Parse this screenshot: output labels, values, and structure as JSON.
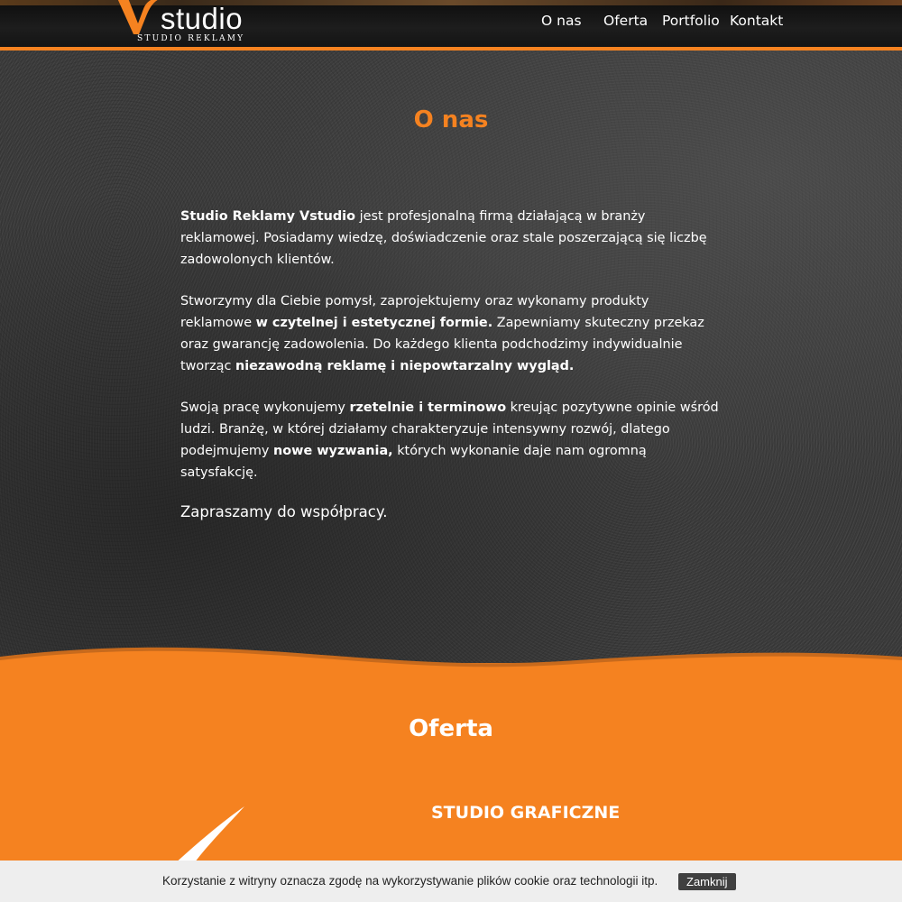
{
  "header": {
    "logo_word": "studio",
    "logo_sub": "STUDIO REKLAMY",
    "nav": [
      "O nas",
      "Oferta",
      "Portfolio",
      "Kontakt"
    ]
  },
  "about": {
    "title": "O nas",
    "p1": {
      "b1": "Studio Reklamy Vstudio",
      "t1": " jest profesjonalną firmą działającą w branży reklamowej. Posiadamy wiedzę, doświadczenie oraz stale poszerzającą się liczbę zadowolonych klientów."
    },
    "p2": {
      "t1": "Stworzymy dla Ciebie pomysł, zaprojektujemy oraz wykonamy produkty reklamowe ",
      "b1": "w czytelnej i estetycznej formie.",
      "t2": " Zapewniamy skuteczny przekaz oraz gwarancję zadowolenia. Do każdego klienta podchodzimy indywidualnie tworząc ",
      "b2": "niezawodną reklamę i niepowtarzalny wygląd."
    },
    "p3": {
      "t1": "Swoją pracę wykonujemy ",
      "b1": "rzetelnie i terminowo",
      "t2": " kreując pozytywne opinie wśród ludzi. Branżę, w której działamy charakteryzuje intensywny rozwój, dlatego podejmujemy ",
      "b2": "nowe wyzwania,",
      "t3": " których wykonanie daje nam ogromną satysfakcję."
    },
    "invite": "Zapraszamy do współpracy."
  },
  "offer": {
    "title": "Oferta",
    "subtitle": "STUDIO GRAFICZNE"
  },
  "cookie": {
    "text": "Korzystanie z witryny oznacza zgodę na wykorzystywanie plików cookie oraz technologii itp.",
    "button": "Zamknij"
  },
  "colors": {
    "accent": "#f58220",
    "header_bg": "#141414",
    "about_bg": "#3a3a3a",
    "cookie_bg": "#eeeeee",
    "cookie_button": "#404040"
  }
}
